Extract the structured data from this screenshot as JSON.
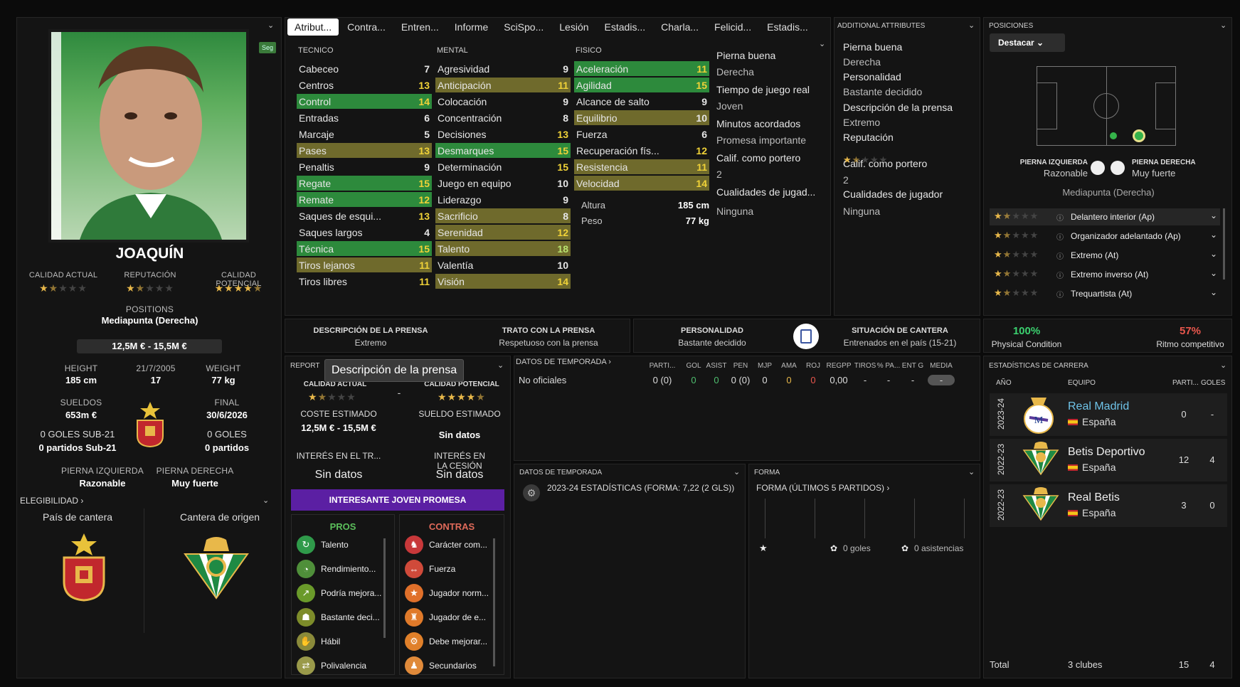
{
  "player": {
    "name": "JOAQUÍN",
    "seg": "Seg",
    "calidad_actual_label": "CALIDAD ACTUAL",
    "reputacion_label": "REPUTACIÓN",
    "calidad_potencial_label": "CALIDAD POTENCIAL",
    "calidad_actual_stars": 1.5,
    "reputacion_stars": 1.5,
    "calidad_potencial_stars": 4.5,
    "positions_label": "POSITIONS",
    "position": "Mediapunta (Derecha)",
    "value": "12,5M € - 15,5M €",
    "height_label": "HEIGHT",
    "height": "185 cm",
    "dob": "21/7/2005",
    "age": "17",
    "weight_label": "WEIGHT",
    "weight": "77 kg",
    "sueldos_label": "SUELDOS",
    "sueldos": "653m €",
    "final_label": "FINAL",
    "final": "30/6/2026",
    "goles_sub21": "0 GOLES SUB-21",
    "partidos_sub21": "0 partidos Sub-21",
    "goles": "0 GOLES",
    "partidos": "0 partidos",
    "pierna_izq_label": "PIERNA IZQUIERDA",
    "pierna_izq": "Razonable",
    "pierna_der_label": "PIERNA DERECHA",
    "pierna_der": "Muy fuerte",
    "elegibilidad": "ELEGIBILIDAD",
    "pais_cantera": "País de cantera",
    "cantera_origen": "Cantera de origen"
  },
  "tabs": [
    "Atribut...",
    "Contra...",
    "Entren...",
    "Informe",
    "SciSpo...",
    "Lesión",
    "Estadis...",
    "Charla...",
    "Felicid...",
    "Estadis..."
  ],
  "attrs": {
    "tecnico_label": "TECNICO",
    "mental_label": "MENTAL",
    "fisico_label": "FISICO",
    "tecnico": [
      [
        "Cabeceo",
        "7",
        ""
      ],
      [
        "Centros",
        "13",
        ""
      ],
      [
        "Control",
        "14",
        "g"
      ],
      [
        "Entradas",
        "6",
        ""
      ],
      [
        "Marcaje",
        "5",
        ""
      ],
      [
        "Pases",
        "13",
        "o"
      ],
      [
        "Penaltis",
        "9",
        ""
      ],
      [
        "Regate",
        "15",
        "g"
      ],
      [
        "Remate",
        "12",
        "g"
      ],
      [
        "Saques de esqui...",
        "13",
        ""
      ],
      [
        "Saques largos",
        "4",
        ""
      ],
      [
        "Técnica",
        "15",
        "g"
      ],
      [
        "Tiros lejanos",
        "11",
        "o"
      ],
      [
        "Tiros libres",
        "11",
        ""
      ]
    ],
    "mental": [
      [
        "Agresividad",
        "9",
        ""
      ],
      [
        "Anticipación",
        "11",
        "o"
      ],
      [
        "Colocación",
        "9",
        ""
      ],
      [
        "Concentración",
        "8",
        ""
      ],
      [
        "Decisiones",
        "13",
        ""
      ],
      [
        "Desmarques",
        "15",
        "g"
      ],
      [
        "Determinación",
        "15",
        ""
      ],
      [
        "Juego en equipo",
        "10",
        ""
      ],
      [
        "Liderazgo",
        "9",
        ""
      ],
      [
        "Sacrificio",
        "8",
        "o"
      ],
      [
        "Serenidad",
        "12",
        "o"
      ],
      [
        "Talento",
        "18",
        "o"
      ],
      [
        "Valentía",
        "10",
        ""
      ],
      [
        "Visión",
        "14",
        "o"
      ]
    ],
    "fisico": [
      [
        "Aceleración",
        "11",
        "g"
      ],
      [
        "Agilidad",
        "15",
        "g"
      ],
      [
        "Alcance de salto",
        "9",
        ""
      ],
      [
        "Equilibrio",
        "10",
        "o"
      ],
      [
        "Fuerza",
        "6",
        ""
      ],
      [
        "Recuperación fís...",
        "12",
        ""
      ],
      [
        "Resistencia",
        "11",
        "o"
      ],
      [
        "Velocidad",
        "14",
        "o"
      ]
    ],
    "altura_label": "Altura",
    "altura": "185 cm",
    "peso_label": "Peso",
    "peso": "77 kg"
  },
  "side_info": [
    [
      "Pierna buena",
      "Derecha"
    ],
    [
      "Tiempo de juego real",
      "Joven"
    ],
    [
      "Minutos acordados",
      "Promesa importante"
    ],
    [
      "Calif. como portero",
      "2"
    ],
    [
      "Cualidades de jugad...",
      "Ninguna"
    ]
  ],
  "additional": {
    "title": "ADDITIONAL ATTRIBUTES",
    "rows": [
      [
        "Pierna buena",
        "Derecha"
      ],
      [
        "Personalidad",
        "Bastante decidido"
      ],
      [
        "Descripción de la prensa",
        "Extremo"
      ],
      [
        "Reputación",
        ""
      ],
      [
        "Calif. como portero",
        "2"
      ],
      [
        "Cualidades de jugador",
        "Ninguna"
      ]
    ]
  },
  "posiciones": {
    "title": "POSICIONES",
    "button": "Destacar",
    "izq_label": "PIERNA IZQUIERDA",
    "izq": "Razonable",
    "der_label": "PIERNA DERECHA",
    "der": "Muy fuerte",
    "position": "Mediapunta (Derecha)",
    "roles": [
      "Delantero interior (Ap)",
      "Organizador adelantado (Ap)",
      "Extremo (At)",
      "Extremo inverso (At)",
      "Trequartista (At)"
    ]
  },
  "strip": {
    "desc_label": "DESCRIPCIÓN DE LA PRENSA",
    "desc": "Extremo",
    "trato_label": "TRATO CON LA PRENSA",
    "trato": "Respetuoso con la prensa",
    "pers_label": "PERSONALIDAD",
    "pers": "Bastante decidido",
    "sit_label": "SITUACIÓN DE CANTERA",
    "sit": "Entrenados en el país (15-21)",
    "cond": "100%",
    "cond_label": "Physical Condition",
    "ritmo": "57%",
    "ritmo_label": "Ritmo competitivo"
  },
  "report": {
    "title": "REPORT",
    "tooltip": "Descripción de la prensa",
    "ca_label": "CALIDAD ACTUAL",
    "cp_label": "CALIDAD POTENCIAL",
    "dash": "-",
    "coste_label": "COSTE ESTIMADO",
    "coste": "12,5M € - 15,5M €",
    "sueldo_label": "SUELDO ESTIMADO",
    "sueldo": "Sin datos",
    "interes_tr_label": "INTERÉS EN EL TR...",
    "interes_tr": "Sin datos",
    "interes_ces_label": "INTERÉS EN LA CESIÓN",
    "interes_ces": "Sin datos",
    "banner": "INTERESANTE JOVEN PROMESA",
    "pros_label": "PROS",
    "contras_label": "CONTRAS",
    "pros": [
      "Talento",
      "Rendimiento...",
      "Podría mejora...",
      "Bastante deci...",
      "Hábil",
      "Polivalencia"
    ],
    "contras": [
      "Carácter com...",
      "Fuerza",
      "Jugador norm...",
      "Jugador de e...",
      "Debe mejorar...",
      "Secundarios"
    ]
  },
  "temporada": {
    "title": "DATOS DE TEMPORADA",
    "cols": [
      "PARTI...",
      "GOL",
      "ASIST",
      "PEN",
      "MJP",
      "AMA",
      "ROJ",
      "REGPP",
      "TIROS",
      "% PA...",
      "ENT G",
      "MEDIA"
    ],
    "row_label": "No oficiales",
    "row": [
      "0 (0)",
      "0",
      "0",
      "0 (0)",
      "0",
      "0",
      "0",
      "0,00",
      "-",
      "-",
      "-",
      "-"
    ]
  },
  "temporada2": {
    "title": "DATOS DE TEMPORADA",
    "line": "2023-24 ESTADÍSTICAS (FORMA: 7,22 (2 GLS))"
  },
  "forma": {
    "title": "FORMA",
    "sub": "FORMA (ÚLTIMOS 5 PARTIDOS)",
    "goles": "0 goles",
    "asist": "0 asistencias"
  },
  "carrera": {
    "title": "ESTADÍSTICAS DE CARRERA",
    "col_year": "AÑO",
    "col_team": "EQUIPO",
    "col_parti": "PARTI...",
    "col_goles": "GOLES",
    "rows": [
      {
        "year": "2023-24",
        "team": "Real Madrid",
        "country": "España",
        "parti": "0",
        "goles": "-"
      },
      {
        "year": "2022-23",
        "team": "Betis Deportivo",
        "country": "España",
        "parti": "12",
        "goles": "4"
      },
      {
        "year": "2022-23",
        "team": "Real Betis",
        "country": "España",
        "parti": "3",
        "goles": "0"
      }
    ],
    "total_label": "Total",
    "total_clubs": "3 clubes",
    "total_parti": "15",
    "total_goles": "4"
  },
  "colors": {
    "green": "#2d8a3c",
    "olive": "#6f6a2c",
    "purple": "#5b1fa3",
    "gold": "#e8b84a",
    "cond": "#3bd16f",
    "ritmo": "#e9574d"
  }
}
